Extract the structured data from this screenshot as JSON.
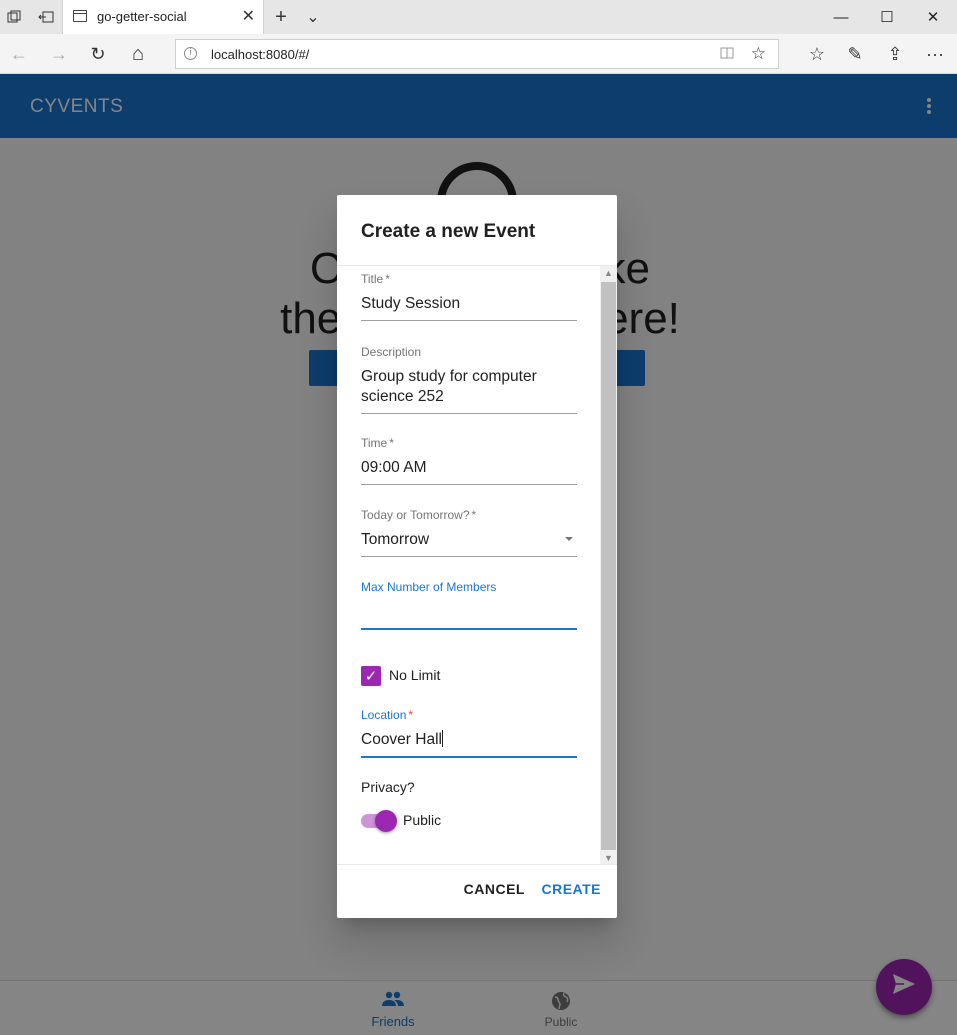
{
  "browser": {
    "tab_title": "go-getter-social",
    "tab_close": "✕",
    "new_tab": "+",
    "tab_list": "⌄",
    "minimize": "—",
    "maximize": "☐",
    "close": "✕",
    "url": "localhost:8080/#/",
    "back": "←",
    "forward": "→",
    "refresh": "↻",
    "home": "⌂",
    "favorite": "☆",
    "favorites_bar": "☆",
    "notes": "✎",
    "share": "⇪",
    "more": "···"
  },
  "app": {
    "title": "CYVENTS",
    "background_heading": "Oh no! Looks like there's nothing here!",
    "bottom_nav": [
      {
        "label": "Friends",
        "icon": "people-icon",
        "active": true
      },
      {
        "label": "Public",
        "icon": "globe-icon",
        "active": false
      }
    ],
    "colors": {
      "primary": "#1976d2",
      "accent": "#9c27b0"
    }
  },
  "dialog": {
    "title": "Create a new Event",
    "fields": {
      "title": {
        "label": "Title",
        "value": "Study Session",
        "required": true
      },
      "description": {
        "label": "Description",
        "value_line1": "Group study for computer",
        "value_line2": "science 252"
      },
      "time": {
        "label": "Time",
        "value": "09:00 AM",
        "required": true
      },
      "day": {
        "label": "Today or Tomorrow?",
        "value": "Tomorrow",
        "required": true
      },
      "max_members": {
        "label": "Max Number of Members",
        "value": ""
      },
      "location": {
        "label": "Location",
        "value": "Coover Hall",
        "required": true
      }
    },
    "no_limit": {
      "label": "No Limit",
      "checked": true
    },
    "privacy": {
      "label": "Privacy?",
      "switch_label": "Public",
      "on": true
    },
    "actions": {
      "cancel": "CANCEL",
      "create": "CREATE"
    }
  }
}
